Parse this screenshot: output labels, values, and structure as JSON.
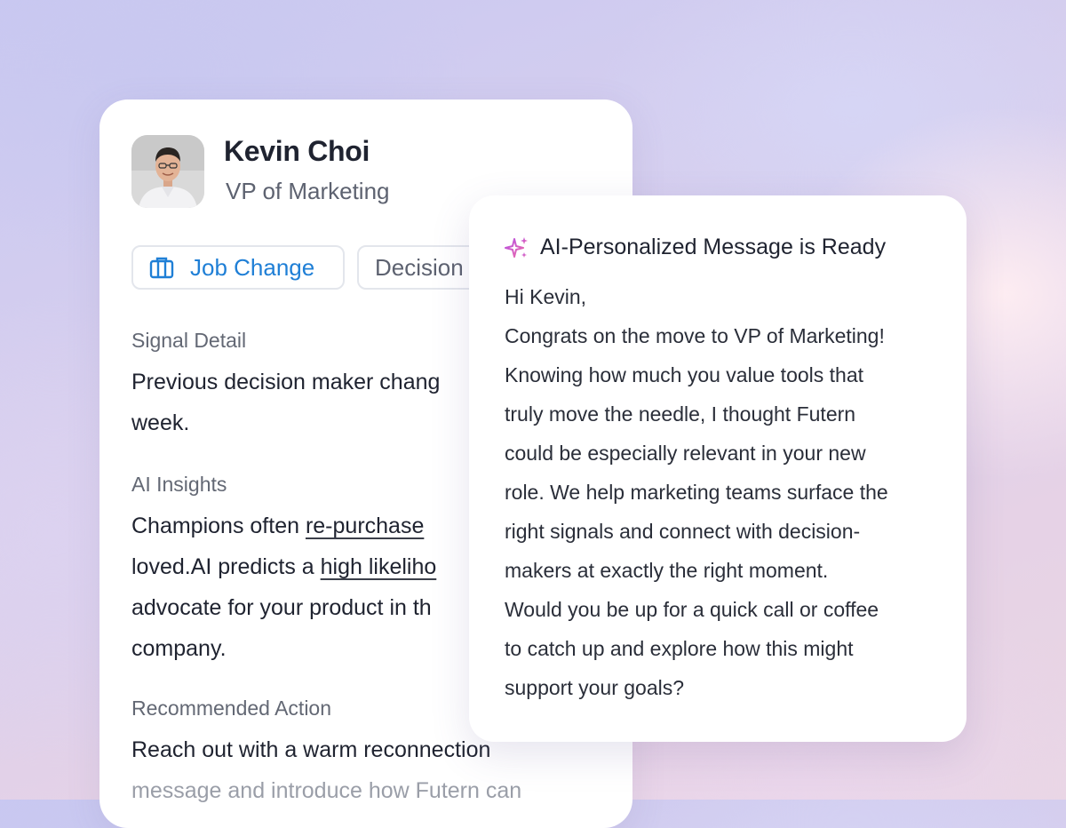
{
  "profile": {
    "name": "Kevin Choi",
    "title": "VP of Marketing",
    "chips": {
      "job_change": "Job Change",
      "decision": "Decision"
    },
    "signal": {
      "label": "Signal Detail",
      "line1": "Previous decision maker chang",
      "line2": "week."
    },
    "insights": {
      "label": "AI Insights",
      "l1_pre": "Champions often ",
      "l1_link": "re-purchase",
      "l2_pre": "loved.AI predicts a ",
      "l2_link": "high likeliho",
      "line3": "advocate for your product in th",
      "line4": "company."
    },
    "action": {
      "label": "Recommended Action",
      "line1": "Reach out with a warm reconnection",
      "line2": "message and introduce how Futern can"
    }
  },
  "message": {
    "title": "AI-Personalized Message is Ready",
    "lines": [
      "Hi Kevin,",
      "Congrats on the move to VP of Marketing!",
      "Knowing how much you value tools that",
      "truly move the needle, I thought Futern",
      "could be especially relevant in your new",
      "role. We help marketing teams surface the",
      "right signals and connect with decision-",
      "makers at exactly the right moment.",
      "Would you be up for a quick call or coffee",
      "to catch up and explore how this might",
      "support your goals?"
    ]
  },
  "icons": {
    "job_change": "briefcase-icon",
    "sparkle": "sparkle-icon"
  },
  "colors": {
    "accent_blue": "#1f7fd6",
    "sparkle_gradient": [
      "#c04fe0",
      "#e86bb3"
    ]
  }
}
